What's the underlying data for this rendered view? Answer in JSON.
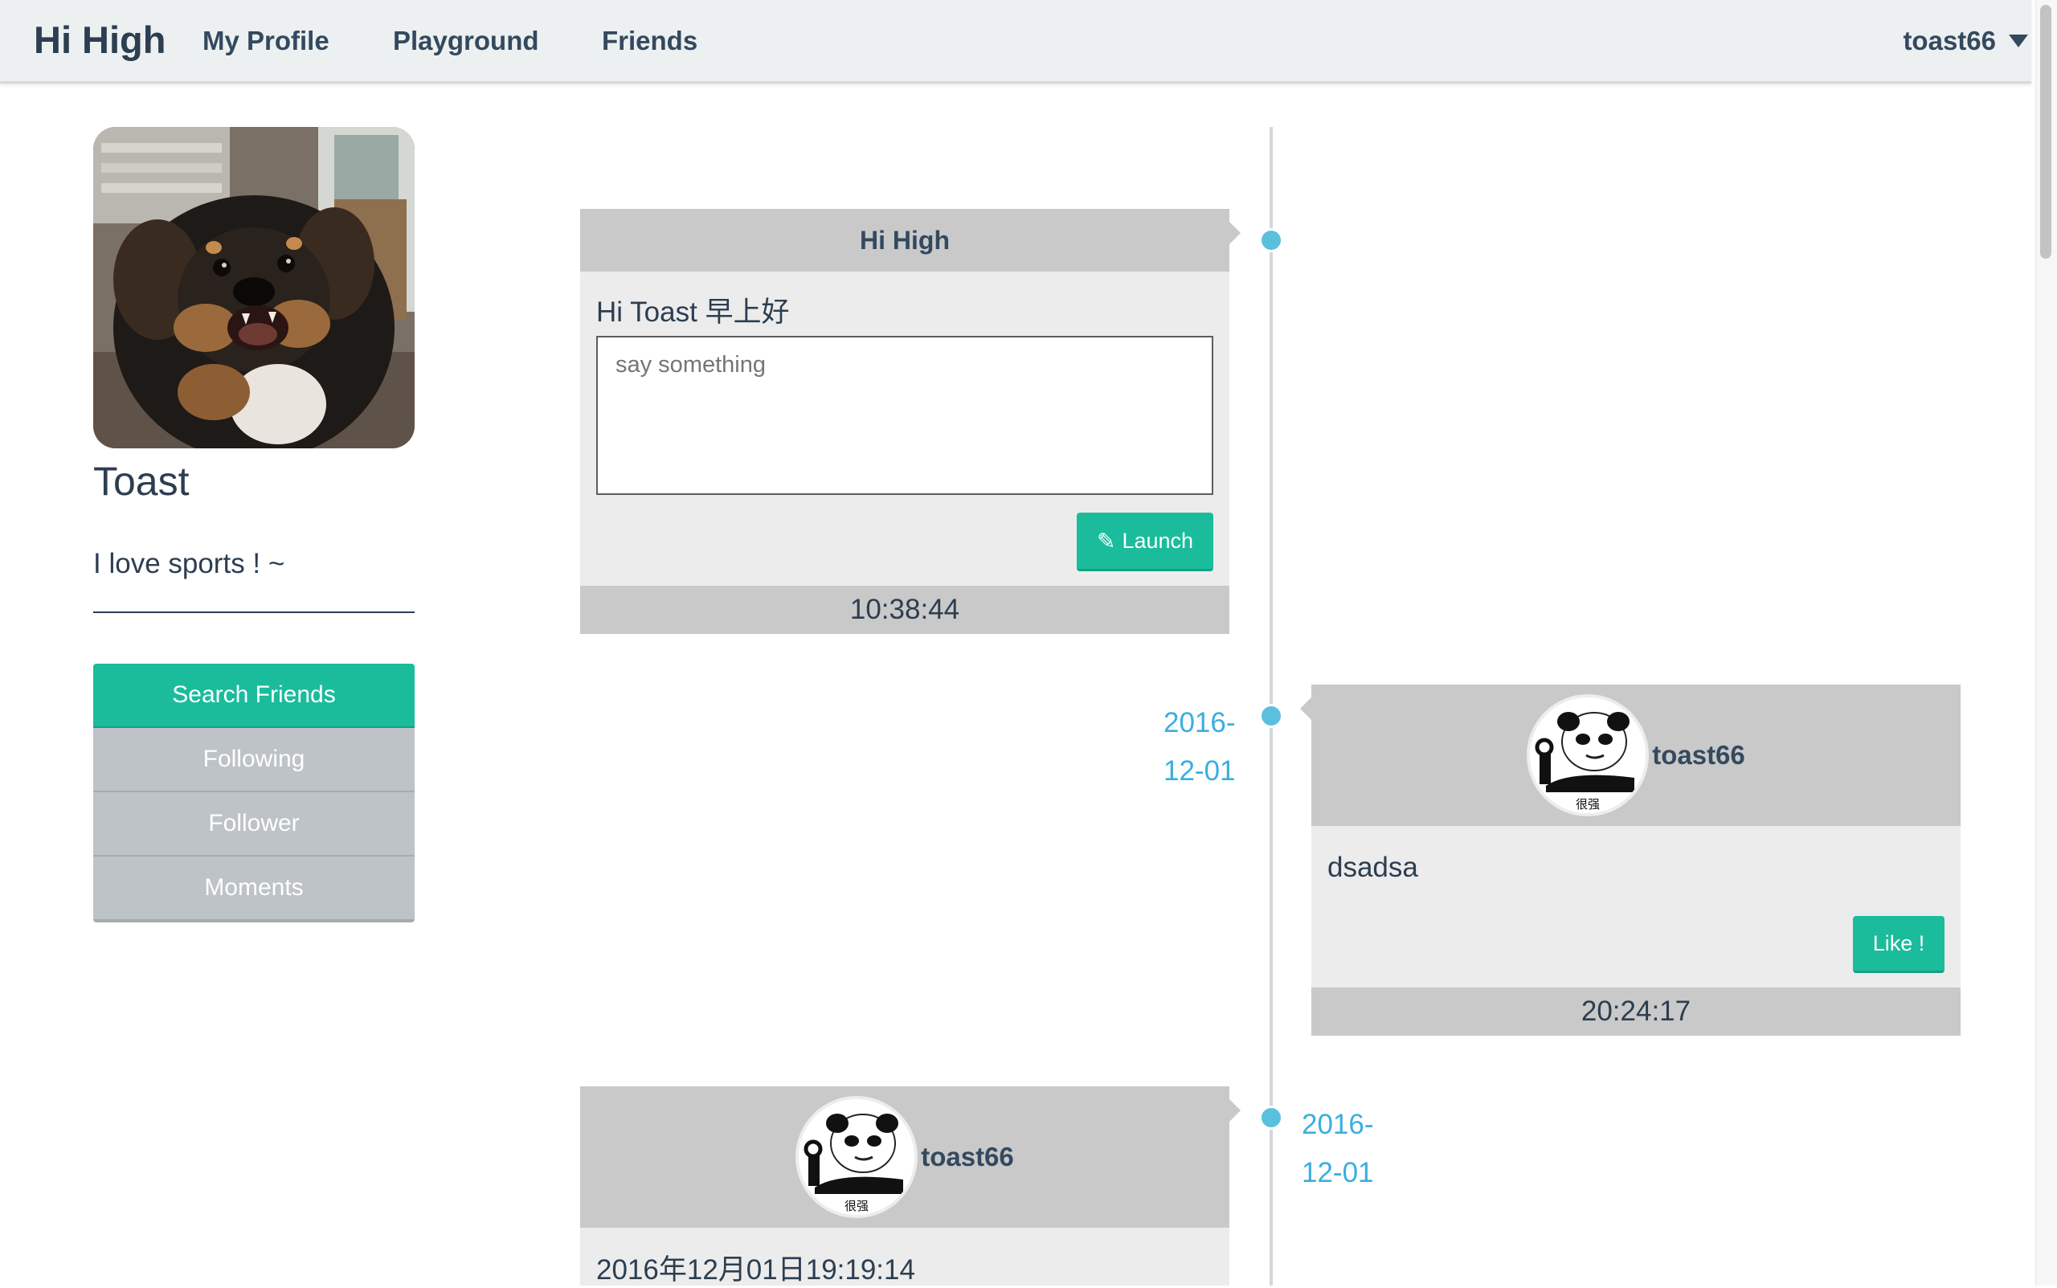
{
  "nav": {
    "brand": "Hi High",
    "links": [
      "My Profile",
      "Playground",
      "Friends"
    ],
    "user": "toast66"
  },
  "profile": {
    "name": "Toast",
    "motto": "I love sports ! ~",
    "menu": [
      "Search Friends",
      "Following",
      "Follower",
      "Moments"
    ]
  },
  "compose": {
    "title": "Hi High",
    "greeting": "Hi Toast 早上好",
    "placeholder": "say something",
    "button": "Launch",
    "time": "10:38:44"
  },
  "posts": [
    {
      "date_line1": "2016-",
      "date_line2": "12-01",
      "user": "toast66",
      "avatar_caption": "很强",
      "text": "dsadsa",
      "like_button": "Like !",
      "time": "20:24:17"
    },
    {
      "date_line1": "2016-",
      "date_line2": "12-01",
      "user": "toast66",
      "avatar_caption": "很强",
      "text": "2016年12月01日19:19:14"
    }
  ],
  "colors": {
    "accent": "#1abc9c",
    "timeline_dot": "#5bc0de",
    "date_text": "#3aaee0",
    "menu_inactive": "#bdc3c7",
    "card_header": "#c9c9c9"
  },
  "icons": [
    "caret-down-icon",
    "pencil-icon"
  ]
}
